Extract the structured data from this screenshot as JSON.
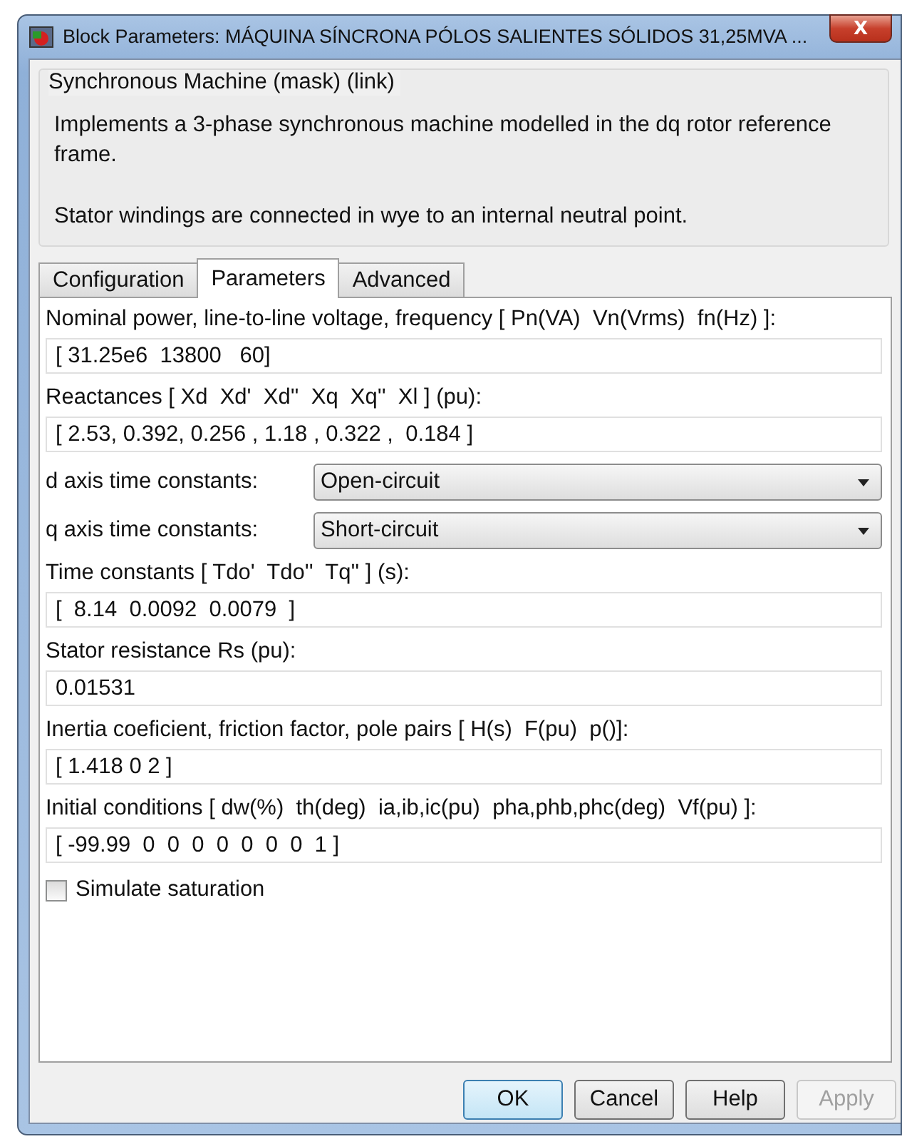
{
  "window": {
    "title": "Block Parameters: MÁQUINA SÍNCRONA PÓLOS SALIENTES SÓLIDOS 31,25MVA ...",
    "close": "X"
  },
  "description": {
    "title": "Synchronous Machine (mask) (link)",
    "paragraphs": [
      "Implements a 3-phase synchronous machine modelled in the dq rotor reference frame.",
      "Stator windings are connected in wye to an internal neutral point."
    ]
  },
  "tabs": [
    {
      "label": "Configuration",
      "selected": false
    },
    {
      "label": "Parameters",
      "selected": true
    },
    {
      "label": "Advanced",
      "selected": false
    }
  ],
  "params": [
    {
      "kind": "field",
      "label": "Nominal power, line-to-line voltage, frequency [ Pn(VA)  Vn(Vrms)  fn(Hz) ]:",
      "value": "[ 31.25e6  13800   60]"
    },
    {
      "kind": "field",
      "label": "Reactances [ Xd  Xd'  Xd''  Xq  Xq''  Xl ] (pu):",
      "value": "[ 2.53, 0.392, 0.256 , 1.18 , 0.322 ,  0.184 ]"
    },
    {
      "kind": "select",
      "label": "d axis time constants:",
      "value": "Open-circuit"
    },
    {
      "kind": "select",
      "label": "q axis time constants:",
      "value": "Short-circuit"
    },
    {
      "kind": "field",
      "label": "Time constants [ Tdo'  Tdo''  Tq'' ] (s):",
      "value": "[  8.14  0.0092  0.0079  ]"
    },
    {
      "kind": "field",
      "label": "Stator resistance Rs (pu):",
      "value": "0.01531"
    },
    {
      "kind": "field",
      "label": "Inertia coeficient, friction factor, pole pairs [ H(s)  F(pu)  p()]:",
      "value": "[ 1.418 0 2 ]"
    },
    {
      "kind": "field",
      "label": "Initial conditions [ dw(%)  th(deg)  ia,ib,ic(pu)  pha,phb,phc(deg)  Vf(pu) ]:",
      "value": "[ -99.99  0  0  0  0  0  0  0  1 ]"
    },
    {
      "kind": "checkbox",
      "label": "Simulate saturation",
      "checked": false
    }
  ],
  "buttons": [
    {
      "label": "OK",
      "default": true,
      "disabled": false
    },
    {
      "label": "Cancel",
      "default": false,
      "disabled": false
    },
    {
      "label": "Help",
      "default": false,
      "disabled": false
    },
    {
      "label": "Apply",
      "default": false,
      "disabled": true
    }
  ]
}
